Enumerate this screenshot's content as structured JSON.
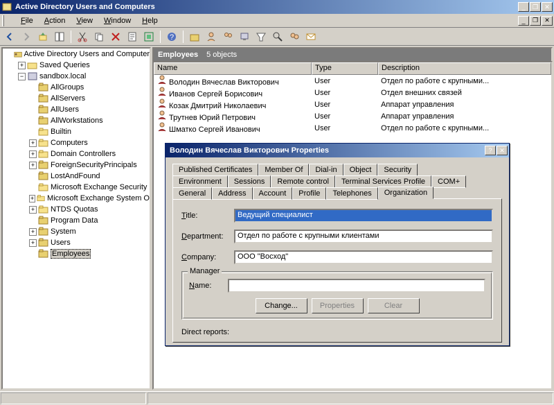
{
  "window": {
    "title": "Active Directory Users and Computers"
  },
  "menus": [
    "File",
    "Action",
    "View",
    "Window",
    "Help"
  ],
  "tree": {
    "root": "Active Directory Users and Computer",
    "saved_queries": "Saved Queries",
    "domain": "sandbox.local",
    "ous": [
      "AllGroups",
      "AllServers",
      "AllUsers",
      "AllWorkstations",
      "Builtin",
      "Computers",
      "Domain Controllers",
      "ForeignSecurityPrincipals",
      "LostAndFound",
      "Microsoft Exchange Security",
      "Microsoft Exchange System O",
      "NTDS Quotas",
      "Program Data",
      "System",
      "Users",
      "Employees"
    ]
  },
  "right_pane": {
    "header_title": "Employees",
    "header_count": "5 objects",
    "columns": [
      "Name",
      "Type",
      "Description"
    ],
    "rows": [
      {
        "name": "Володин Вячеслав Викторович",
        "type": "User",
        "desc": "Отдел по работе с крупными..."
      },
      {
        "name": "Иванов Сергей Борисович",
        "type": "User",
        "desc": "Отдел внешних связей"
      },
      {
        "name": "Козак Дмитрий Николаевич",
        "type": "User",
        "desc": "Аппарат управления"
      },
      {
        "name": "Трутнев Юрий Петрович",
        "type": "User",
        "desc": "Аппарат управления"
      },
      {
        "name": "Шматко Сергей Иванович",
        "type": "User",
        "desc": "Отдел по работе с крупными..."
      }
    ]
  },
  "dialog": {
    "title": "Володин Вячеслав Викторович Properties",
    "tabs_row1": [
      "Published Certificates",
      "Member Of",
      "Dial-in",
      "Object",
      "Security"
    ],
    "tabs_row2": [
      "Environment",
      "Sessions",
      "Remote control",
      "Terminal Services Profile",
      "COM+"
    ],
    "tabs_row3": [
      "General",
      "Address",
      "Account",
      "Profile",
      "Telephones",
      "Organization"
    ],
    "active_tab": "Organization",
    "fields": {
      "title_label": "Title:",
      "title_value": "Ведущий специалист",
      "dept_label": "Department:",
      "dept_value": "Отдел по работе с крупными клиентами",
      "company_label": "Company:",
      "company_value": "ООО \"Восход\""
    },
    "manager_group": "Manager",
    "manager_name_label": "Name:",
    "manager_name_value": "",
    "buttons": {
      "change": "Change...",
      "properties": "Properties",
      "clear": "Clear"
    },
    "direct_reports": "Direct reports:"
  }
}
